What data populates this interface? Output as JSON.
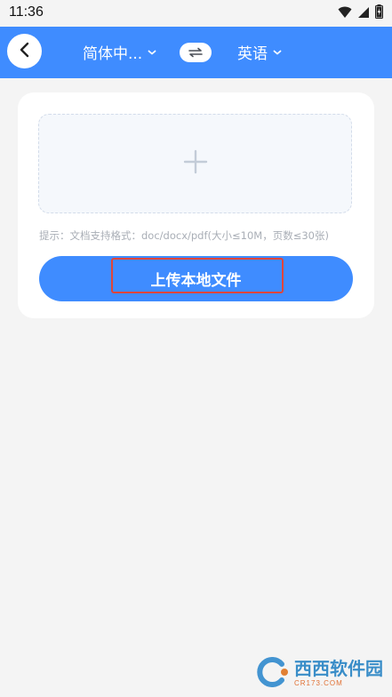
{
  "status_bar": {
    "time": "11:36",
    "icons": [
      "wifi-icon",
      "signal-icon",
      "battery-icon"
    ]
  },
  "header": {
    "source_language": "简体中...",
    "target_language": "英语",
    "background_color": "#3f8cff"
  },
  "upload": {
    "hint": "提示：文档支持格式：doc/docx/pdf(大小≤10M，页数≤30张)",
    "button_label": "上传本地文件",
    "button_color": "#3f8cff"
  },
  "watermark": {
    "brand": "西西软件园",
    "domain": "CR173.COM"
  }
}
